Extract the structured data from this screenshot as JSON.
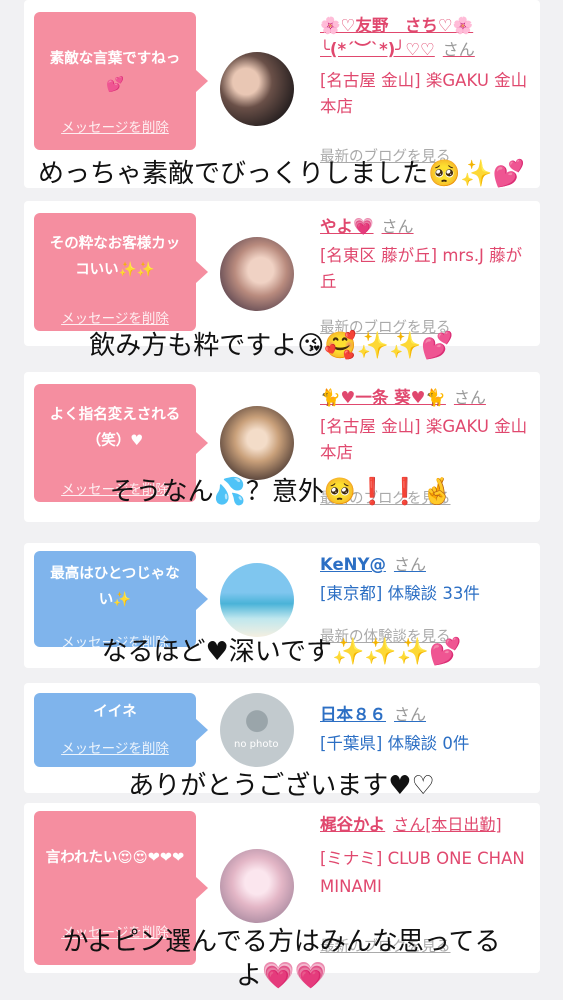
{
  "cards": [
    {
      "message": "素敵な言葉ですねっ💕",
      "delete_label": "メッセージを削除",
      "name": "🌸♡友野　さち♡🌸\n╰(*´︶`*)╯♡♡",
      "name_line1": "🌸♡友野　さち♡🌸",
      "name_line2": "╰(*´︶`*)╯♡♡",
      "honorific": "さん",
      "location": "[名古屋 金山] 楽GAKU 金山本店",
      "link": "最新のブログを見る",
      "caption": "めっちゃ素敵でびっくりしました🥺✨💕"
    },
    {
      "message": "その粋なお客様カッコいい✨✨",
      "delete_label": "メッセージを削除",
      "name": "やよ💗",
      "honorific": "さん",
      "location": "[名東区 藤が丘] mrs.J 藤が丘",
      "link": "最新のブログを見る",
      "caption": "飲み方も粋ですよ😘🥰✨✨💕"
    },
    {
      "message": "よく指名変えされる（笑）♥",
      "delete_label": "メッセージを削除",
      "name": "🐈♥一条 葵♥🐈",
      "honorific": "さん",
      "location": "[名古屋 金山] 楽GAKU 金山本店",
      "link": "最新のブログを見る",
      "caption": "そうなん💦？意外🥺❗❗🤞"
    },
    {
      "message": "最高はひとつじゃない✨",
      "delete_label": "メッセージを削除",
      "name": "KeNY@",
      "honorific": "さん",
      "location": "[東京都] 体験談 33件",
      "link": "最新の体験談を見る",
      "caption": "なるほど♥深いです✨✨✨💕"
    },
    {
      "message": "イイネ",
      "delete_label": "メッセージを削除",
      "name": "日本８６",
      "honorific": "さん",
      "location": "[千葉県] 体験談 0件",
      "avatar_text": "no photo",
      "caption": "ありがとうございます♥♡"
    },
    {
      "message": "言われたい😍😍❤❤❤",
      "delete_label": "メッセージを削除",
      "name": "梶谷かよ",
      "honorific": "さん[本日出勤]",
      "location": "[ミナミ] CLUB ONE CHAN MINAMI",
      "link": "最新のブログを見る",
      "caption_line1": "かよピン選んでる方はみんな思ってる",
      "caption_line2": "よ💗💗"
    }
  ],
  "colors": {
    "pink_bubble": "#f58ea0",
    "blue_bubble": "#7fb4ec",
    "pink_text": "#e0486e",
    "blue_text": "#2c6fc4",
    "background": "#f1f1f3"
  }
}
